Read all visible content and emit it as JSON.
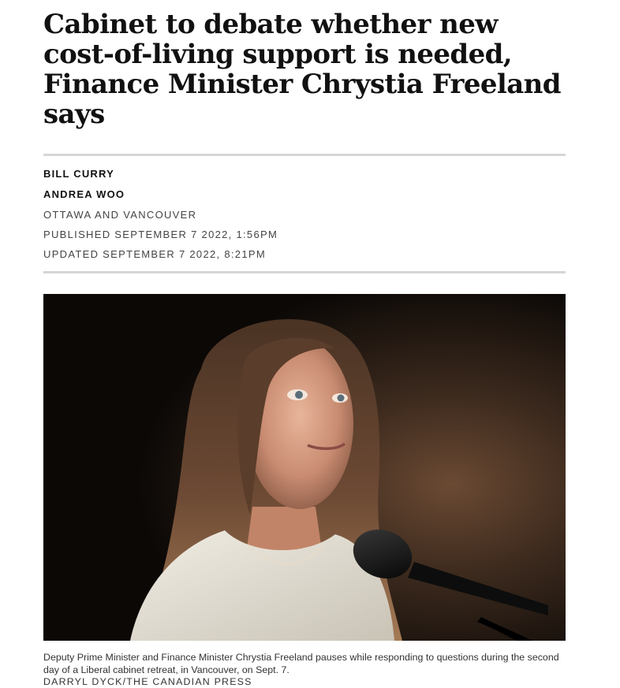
{
  "article": {
    "headline": "Cabinet to debate whether new cost-of-living support is needed, Finance Minister Chrystia Freeland says",
    "authors": [
      "BILL CURRY",
      "ANDREA WOO"
    ],
    "location": "OTTAWA AND VANCOUVER",
    "published": "PUBLISHED SEPTEMBER 7 2022, 1:56PM",
    "updated": "UPDATED SEPTEMBER 7 2022, 8:21PM"
  },
  "photo": {
    "caption": "Deputy Prime Minister and Finance Minister Chrystia Freeland pauses while responding to questions during the second day of a Liberal cabinet retreat, in Vancouver, on Sept. 7.",
    "credit": "DARRYL DYCK/THE CANADIAN PRESS"
  }
}
